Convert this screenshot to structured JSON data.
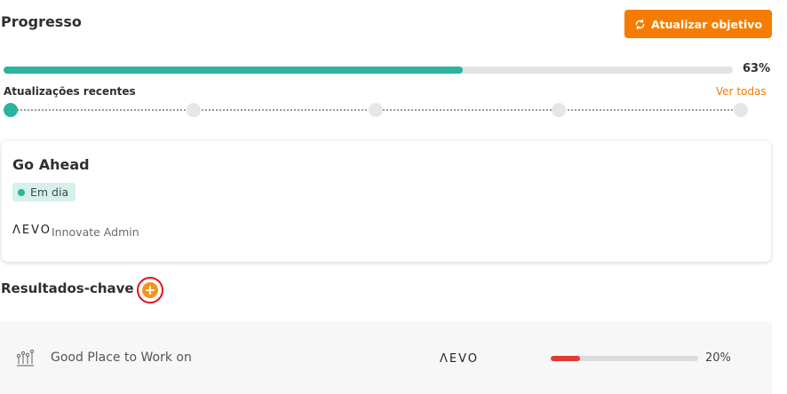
{
  "header": {
    "title": "Progresso",
    "update_button_label": "Atualizar objetivo"
  },
  "progress": {
    "value": 0.63,
    "label": "63%",
    "fill_color": "#2bb3a0"
  },
  "updates": {
    "label": "Atualizações recentes",
    "view_all": "Ver todas",
    "points": 5,
    "active_index": 0
  },
  "objective": {
    "name": "Go Ahead",
    "status": "Em dia",
    "status_color": "#2bb3a0",
    "owner_logo": "ΛEVO",
    "owner_name": "Innovate Admin"
  },
  "key_results": {
    "title": "Resultados-chave",
    "add_icon": "plus-icon",
    "items": [
      {
        "icon": "chart-people-icon",
        "name": "Good Place to Work on",
        "owner_logo": "ΛEVO",
        "progress": 0.2,
        "progress_label": "20%",
        "progress_color": "#e53935"
      }
    ]
  },
  "colors": {
    "accent": "#f57c00",
    "highlight_ring": "#e01020"
  }
}
